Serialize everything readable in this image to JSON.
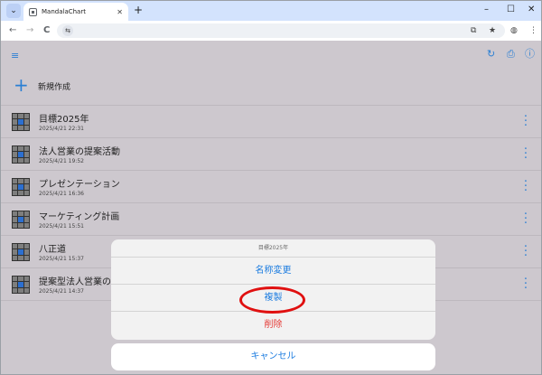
{
  "browser": {
    "tab_title": "MandalaChart",
    "tab_close": "✕",
    "tab_search": "⌄",
    "new_tab": "+",
    "win_min": "–",
    "win_max": "☐",
    "win_close": "✕",
    "back": "←",
    "forward": "→",
    "reload": "C",
    "site_info": "⇆",
    "cast": "⧉",
    "bookmark": "★",
    "profile": "◍",
    "menu": "⋮"
  },
  "app": {
    "sort_icon": "≡",
    "refresh_icon": "↻",
    "export_icon": "⎙",
    "info_icon": "ⓘ",
    "new_label": "新規作成",
    "items": [
      {
        "title": "目標2025年",
        "date": "2025/4/21 22:31"
      },
      {
        "title": "法人営業の提案活動",
        "date": "2025/4/21 19:52"
      },
      {
        "title": "プレゼンテーション",
        "date": "2025/4/21 16:36"
      },
      {
        "title": "マーケティング計画",
        "date": "2025/4/21 15:51"
      },
      {
        "title": "八正道",
        "date": "2025/4/21 15:37"
      },
      {
        "title": "提案型法人営業の",
        "date": "2025/4/21 14:37"
      }
    ]
  },
  "sheet": {
    "title": "目標2025年",
    "rename": "名称変更",
    "duplicate": "複製",
    "delete": "削除",
    "cancel": "キャンセル"
  },
  "colors": {
    "accent": "#1e7de0",
    "danger": "#e53935",
    "highlight": "#e01010"
  }
}
